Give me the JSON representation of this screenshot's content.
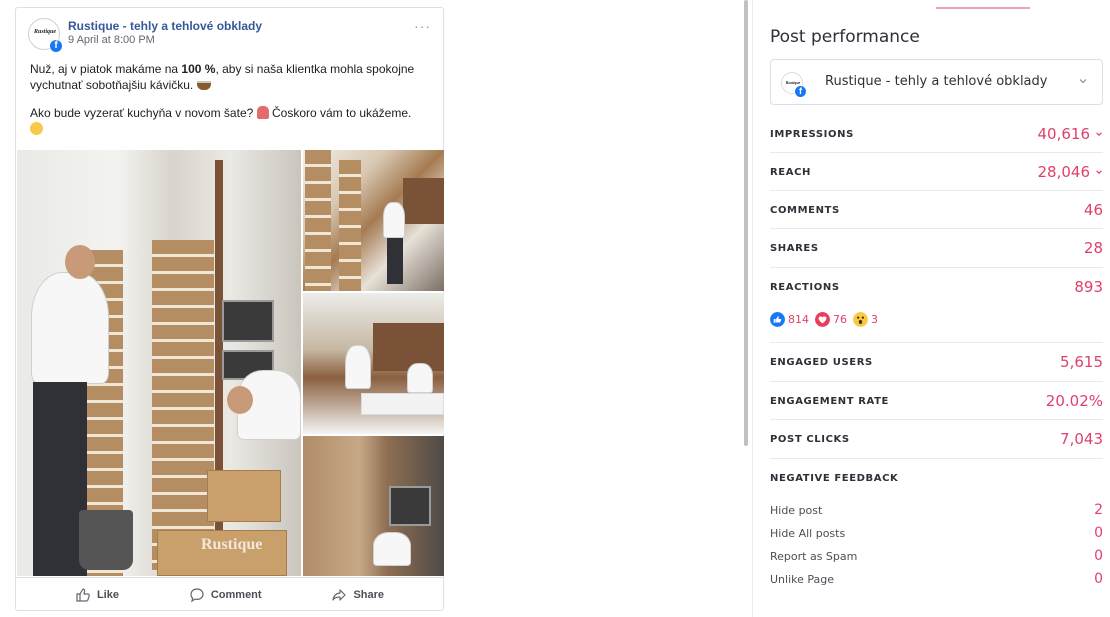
{
  "post": {
    "page_name": "Rustique - tehly a tehlové obklady",
    "avatar_logo_text": "Rustique",
    "date": "9 April at 8:00 PM",
    "more_label": "···",
    "text_p1_a": "Nuž, aj v piatok makáme na ",
    "text_p1_bold": "100 %",
    "text_p1_b": ", aby si naša klientka mohla spokojne vychutnať sobotňajšiu kávičku.",
    "text_p2": "Ako bude vyzerať kuchyňa v novom šate?",
    "text_p2_b": " Čoskoro vám to ukážeme.",
    "watermark": "Rustique",
    "actions": {
      "like": "Like",
      "comment": "Comment",
      "share": "Share"
    }
  },
  "performance": {
    "title": "Post performance",
    "account": "Rustique - tehly a tehlové obklady",
    "metrics": [
      {
        "label": "IMPRESSIONS",
        "value": "40,616"
      },
      {
        "label": "REACH",
        "value": "28,046"
      },
      {
        "label": "COMMENTS",
        "value": "46"
      },
      {
        "label": "SHARES",
        "value": "28"
      },
      {
        "label": "REACTIONS",
        "value": "893"
      },
      {
        "label": "ENGAGED USERS",
        "value": "5,615"
      },
      {
        "label": "ENGAGEMENT RATE",
        "value": "20.02%"
      },
      {
        "label": "POST CLICKS",
        "value": "7,043"
      }
    ],
    "reactions": {
      "like": "814",
      "love": "76",
      "wow": "3"
    },
    "negative_feedback": {
      "label": "NEGATIVE FEEDBACK",
      "items": [
        {
          "label": "Hide post",
          "value": "2"
        },
        {
          "label": "Hide All posts",
          "value": "0"
        },
        {
          "label": "Report as Spam",
          "value": "0"
        },
        {
          "label": "Unlike Page",
          "value": "0"
        }
      ]
    }
  },
  "colors": {
    "accent": "#e0406b",
    "facebook": "#1877f2",
    "link": "#365899"
  },
  "icons": [
    "more-icon",
    "facebook-icon",
    "like-icon",
    "comment-icon",
    "share-icon",
    "chevron-down-icon",
    "like-reaction-icon",
    "love-reaction-icon",
    "wow-reaction-icon"
  ]
}
